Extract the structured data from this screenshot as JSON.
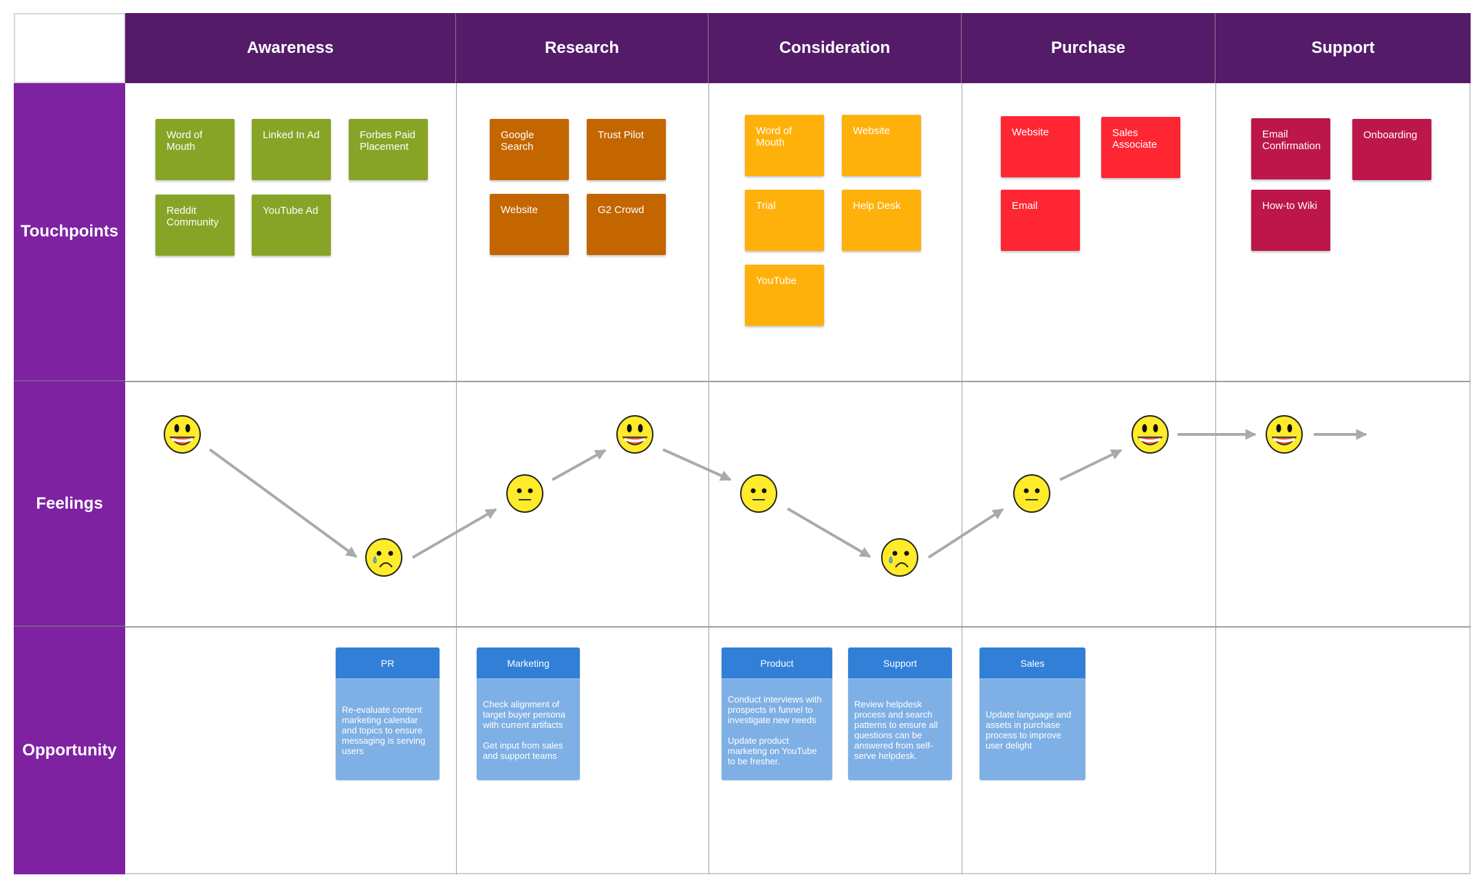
{
  "stages": [
    "Awareness",
    "Research",
    "Consideration",
    "Purchase",
    "Support"
  ],
  "rows": [
    "Touchpoints",
    "Feelings",
    "Opportunity"
  ],
  "colors": {
    "header_bg": "#541b69",
    "row_label_bg": "#7e22a2",
    "awareness": "#88a426",
    "research": "#c46600",
    "consideration": "#ffb10b",
    "purchase": "#fe2633",
    "support": "#bd164a",
    "opp_head": "#327fd8",
    "opp_body": "#7fb0e5",
    "arrow": "#aaaaaa",
    "face": "#ffeb2a"
  },
  "touchpoints": {
    "awareness": [
      "Word of Mouth",
      "Linked In Ad",
      "Forbes Paid Placement",
      "Reddit Community",
      "YouTube Ad"
    ],
    "research": [
      "Google Search",
      "Trust Pilot",
      "Website",
      "G2 Crowd"
    ],
    "consideration": [
      "Word of Mouth",
      "Website",
      "Trial",
      "Help Desk",
      "YouTube"
    ],
    "purchase": [
      "Website",
      "Sales Associate",
      "Email"
    ],
    "support": [
      "Email Confirmation",
      "Onboarding",
      "How-to Wiki"
    ]
  },
  "feelings": [
    {
      "stage": "Awareness",
      "mood": "happy"
    },
    {
      "stage": "Awareness",
      "mood": "sad"
    },
    {
      "stage": "Research",
      "mood": "neutral"
    },
    {
      "stage": "Research",
      "mood": "happy"
    },
    {
      "stage": "Consideration",
      "mood": "neutral"
    },
    {
      "stage": "Consideration",
      "mood": "sad"
    },
    {
      "stage": "Purchase",
      "mood": "neutral"
    },
    {
      "stage": "Purchase",
      "mood": "happy"
    },
    {
      "stage": "Support",
      "mood": "happy"
    }
  ],
  "opportunities": [
    {
      "team": "PR",
      "text": "Re-evaluate content marketing calendar and topics to ensure messaging is serving users"
    },
    {
      "team": "Marketing",
      "text": "Check alignment of target buyer persona with current artifacts\n\nGet input from sales and support teams"
    },
    {
      "team": "Product",
      "text": "Conduct interviews with prospects in funnel to investigate new needs\n\nUpdate product marketing on YouTube to be fresher."
    },
    {
      "team": "Support",
      "text": "Review helpdesk process and search patterns to ensure all questions can be answered from self-serve helpdesk."
    },
    {
      "team": "Sales",
      "text": "Update language and assets in purchase process to improve user delight"
    }
  ]
}
